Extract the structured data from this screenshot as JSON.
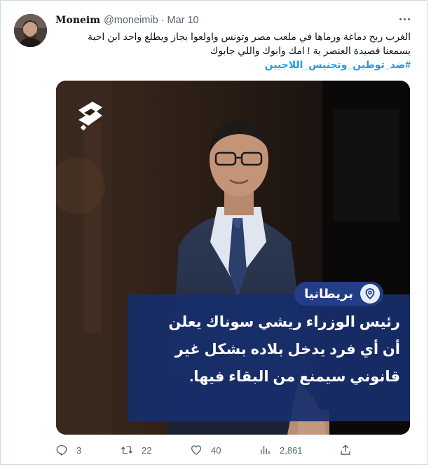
{
  "tweet": {
    "display_name": "Moneim",
    "handle": "@moneimib",
    "separator": "·",
    "date": "Mar 10",
    "text_lines": [
      "الغرب ربح دماغة ورماها في ملعب مصر وتونس واولعوا بجاز ويطلع واحد ابن احبة",
      "يسمعنا قصيدة العنصر ية ! امك وابوك واللي جابوك"
    ],
    "hashtag": "#ضد_توطين_وتجنيس_اللاجيين"
  },
  "media": {
    "location": "بريطانيا",
    "caption_lines": [
      "رئيس الوزراء ريشي سوناك يعلن",
      "أن أي فرد يدخل بلاده بشكل غير",
      "قانوني سيمنع من البقاء فيها."
    ],
    "accent_color": "#223e86"
  },
  "actions": {
    "replies": "3",
    "retweets": "22",
    "likes": "40",
    "views": "2,861"
  },
  "icons": [
    "more-icon",
    "reply-icon",
    "retweet-icon",
    "like-icon",
    "views-icon",
    "share-icon",
    "location-pin-icon",
    "channel-logo"
  ]
}
